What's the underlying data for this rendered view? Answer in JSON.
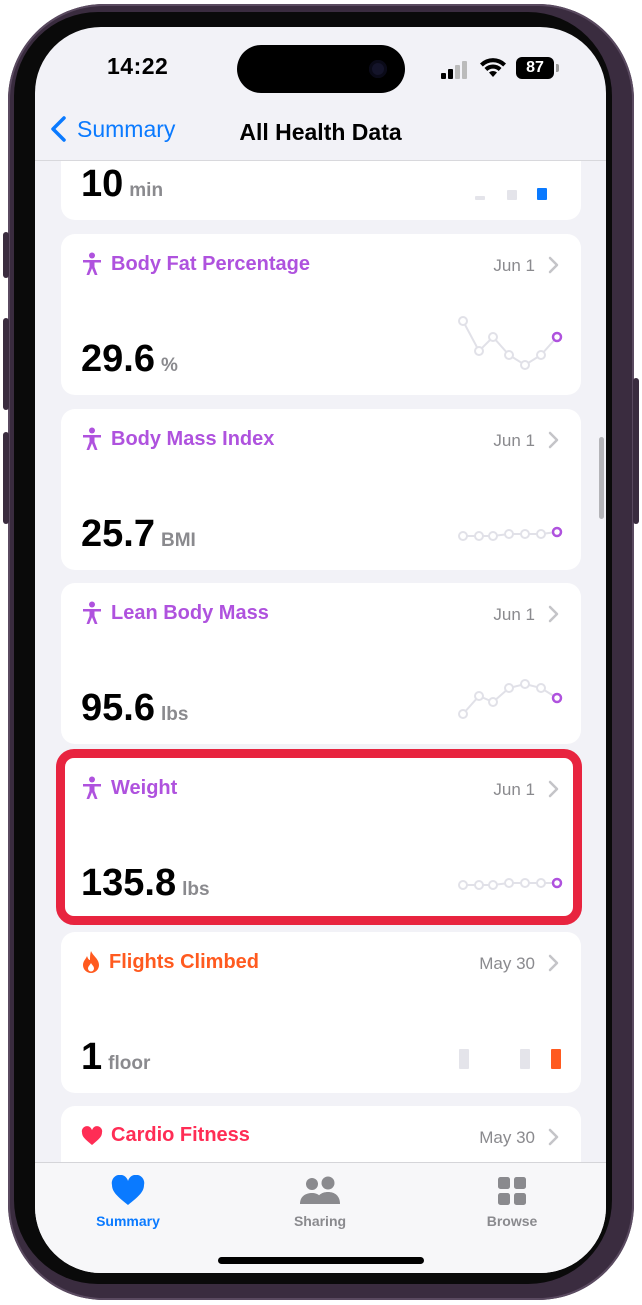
{
  "status_bar": {
    "time": "14:22",
    "battery": "87"
  },
  "nav": {
    "back_label": "Summary",
    "title": "All Health Data"
  },
  "top_partial": {
    "value": "10",
    "unit": "min"
  },
  "cards": [
    {
      "title": "Body Fat Percentage",
      "date": "Jun 1",
      "value": "29.6",
      "unit": "%",
      "color": "#af52de"
    },
    {
      "title": "Body Mass Index",
      "date": "Jun 1",
      "value": "25.7",
      "unit": "BMI",
      "color": "#af52de"
    },
    {
      "title": "Lean Body Mass",
      "date": "Jun 1",
      "value": "95.6",
      "unit": "lbs",
      "color": "#af52de"
    },
    {
      "title": "Weight",
      "date": "Jun 1",
      "value": "135.8",
      "unit": "lbs",
      "color": "#af52de"
    },
    {
      "title": "Flights Climbed",
      "date": "May 30",
      "value": "1",
      "unit": "floor",
      "color": "#ff5a1f"
    },
    {
      "title": "Cardio Fitness",
      "date": "May 30",
      "color": "#ff2d55"
    }
  ],
  "tabbar": [
    {
      "label": "Summary",
      "icon": "heart-icon",
      "active": true
    },
    {
      "label": "Sharing",
      "icon": "people-icon",
      "active": false
    },
    {
      "label": "Browse",
      "icon": "grid-icon",
      "active": false
    }
  ],
  "colors": {
    "accent": "#0a7aff",
    "body_measurement": "#af52de",
    "activity": "#ff5a1f",
    "heart": "#ff2d55",
    "highlight": "#e8243f"
  }
}
